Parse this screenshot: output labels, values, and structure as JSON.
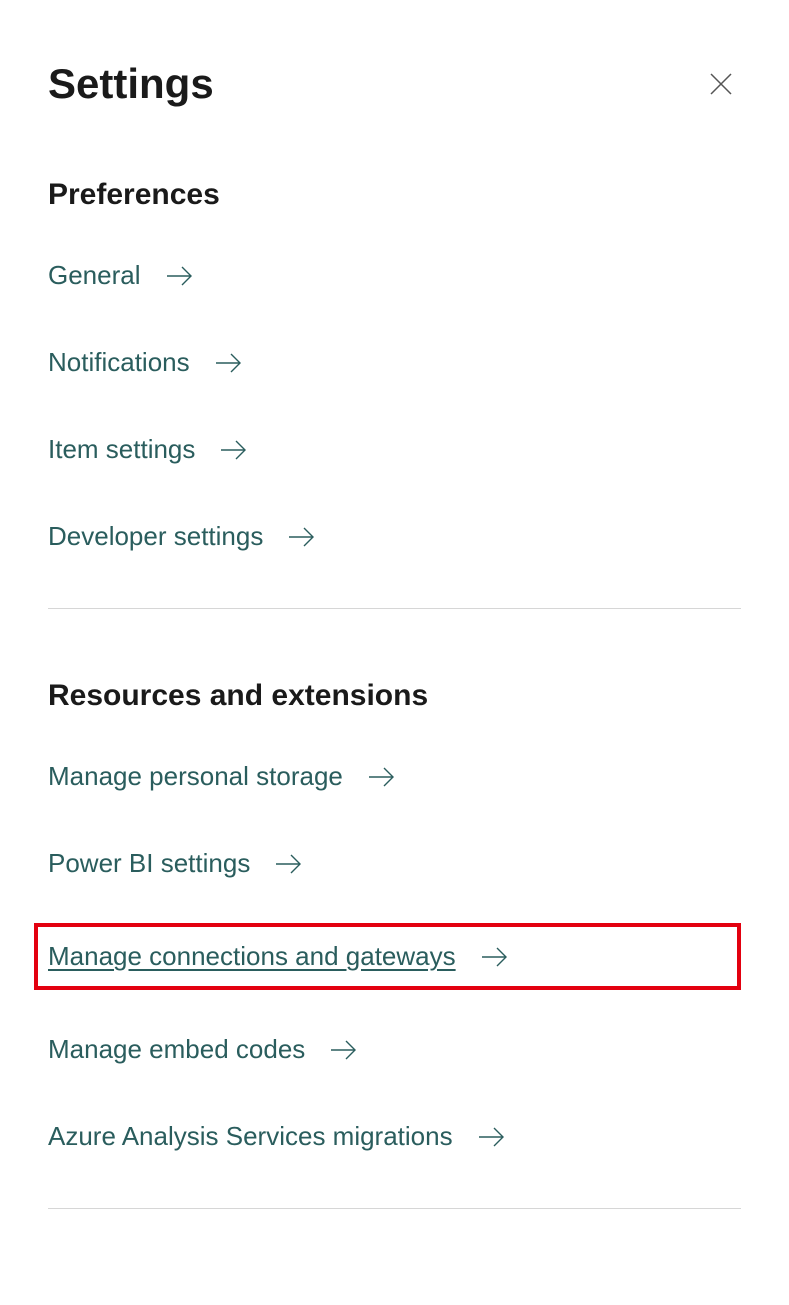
{
  "header": {
    "title": "Settings"
  },
  "sections": {
    "preferences": {
      "title": "Preferences",
      "items": [
        {
          "label": "General"
        },
        {
          "label": "Notifications"
        },
        {
          "label": "Item settings"
        },
        {
          "label": "Developer settings"
        }
      ]
    },
    "resources": {
      "title": "Resources and extensions",
      "items": [
        {
          "label": "Manage personal storage"
        },
        {
          "label": "Power BI settings"
        },
        {
          "label": "Manage connections and gateways"
        },
        {
          "label": "Manage embed codes"
        },
        {
          "label": "Azure Analysis Services migrations"
        }
      ]
    }
  }
}
